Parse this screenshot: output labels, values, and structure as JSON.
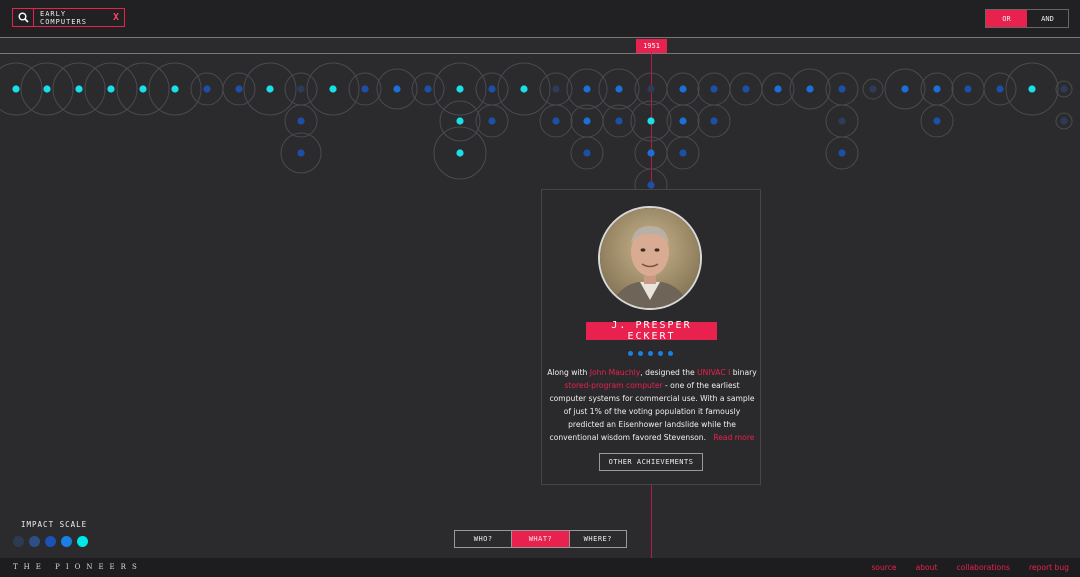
{
  "search": {
    "tag": "EARLY COMPUTERS",
    "clear": "X"
  },
  "logic": {
    "or": "OR",
    "and": "AND"
  },
  "timeline": {
    "year": "1951"
  },
  "card": {
    "name": "J. PRESPER ECKERT",
    "impact_level": 5,
    "desc_1": "Along with ",
    "link_1": "John Mauchly",
    "desc_2": ", designed the ",
    "link_2": "UNIVAC I",
    "desc_3": " binary ",
    "link_3": "stored-program computer",
    "desc_4": " - one of the earliest computer systems for commercial use. With a sample of just 1% of the voting population it famously predicted an Eisenhower landslide while the conventional wisdom favored Stevenson.",
    "read_more": "Read more",
    "button": "OTHER ACHIEVEMENTS"
  },
  "impact_scale": {
    "label": "IMPACT SCALE",
    "colors": [
      "#2c3a54",
      "#2d4f86",
      "#1a52b8",
      "#1a80e6",
      "#00e8e8"
    ]
  },
  "tabs": {
    "who": "WHO?",
    "what": "WHAT?",
    "where": "WHERE?",
    "active": "what"
  },
  "footer": {
    "brand": "THE PIONEERS",
    "links": [
      "source",
      "about",
      "collaborations",
      "report bug"
    ]
  },
  "colors": {
    "accent": "#e8214f",
    "background": "#2b2b2d"
  },
  "icons": {
    "search": "search-icon"
  }
}
